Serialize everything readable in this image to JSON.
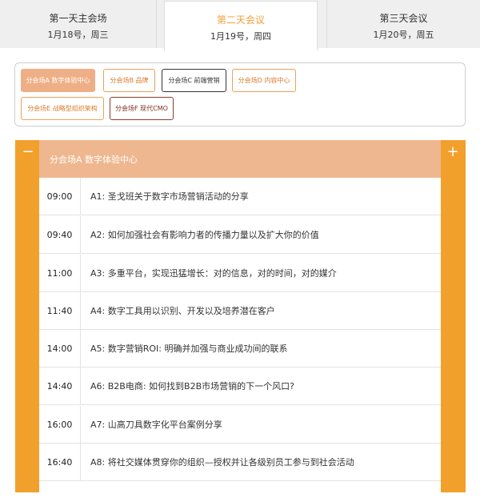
{
  "days": [
    {
      "title": "第一天主会场",
      "date": "1月18号，周三"
    },
    {
      "title": "第二天会议",
      "date": "1月19号，周四"
    },
    {
      "title": "第三天会议",
      "date": "1月20号，周五"
    }
  ],
  "active_day": 1,
  "venues": [
    {
      "label": "分会场A 数字体验中心"
    },
    {
      "label": "分会场B 品牌"
    },
    {
      "label": "分会场C 前端营销"
    },
    {
      "label": "分会场D 内容中心"
    },
    {
      "label": "分会场E 战略型组织架构"
    },
    {
      "label": "分会场F 现代CMO"
    }
  ],
  "panel": {
    "title": "分会场A 数字体验中心",
    "minus": "−",
    "plus": "+"
  },
  "sessions": [
    {
      "time": "09:00",
      "topic": "A1: 圣戈班关于数字市场营销活动的分享"
    },
    {
      "time": "09:40",
      "topic": "A2: 如何加强社会有影响力者的传播力量以及扩大你的价值"
    },
    {
      "time": "11:00",
      "topic": "A3: 多重平台，实现迅猛增长：对的信息，对的时间，对的媒介"
    },
    {
      "time": "11:40",
      "topic": "A4: 数字工具用以识别、开发以及培养潜在客户"
    },
    {
      "time": "14:00",
      "topic": "A5: 数字营销ROI: 明确并加强与商业成功间的联系"
    },
    {
      "time": "14:40",
      "topic": "A6: B2B电商: 如何找到B2B市场营销的下一个风口?"
    },
    {
      "time": "16:00",
      "topic": "A7: 山高刀具数字化平台案例分享"
    },
    {
      "time": "16:40",
      "topic": "A8: 将社交媒体贯穿你的组织—授权并让各级别员工参与到社会活动"
    }
  ]
}
